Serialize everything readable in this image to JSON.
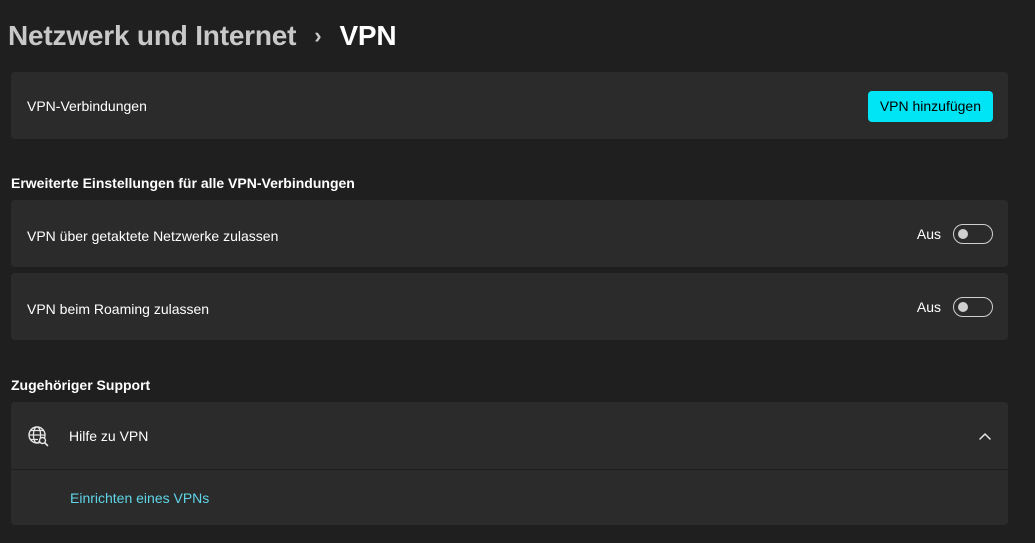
{
  "breadcrumb": {
    "parent": "Netzwerk und Internet",
    "separator": "›",
    "current": "VPN"
  },
  "vpn_connections": {
    "label": "VPN-Verbindungen",
    "add_button": "VPN hinzufügen"
  },
  "advanced": {
    "section_title": "Erweiterte Einstellungen für alle VPN-Verbindungen",
    "metered": {
      "label": "VPN über getaktete Netzwerke zulassen",
      "state_text": "Aus",
      "on": false
    },
    "roaming": {
      "label": "VPN beim Roaming zulassen",
      "state_text": "Aus",
      "on": false
    }
  },
  "support": {
    "section_title": "Zugehöriger Support",
    "help": {
      "label": "Hilfe zu VPN",
      "icon": "globe-search-icon",
      "expanded": true
    },
    "links": [
      "Einrichten eines VPNs"
    ]
  },
  "colors": {
    "accent": "#00e5f5",
    "link": "#5fd6e8",
    "background": "#1f1f1f",
    "card": "#2b2b2b"
  }
}
